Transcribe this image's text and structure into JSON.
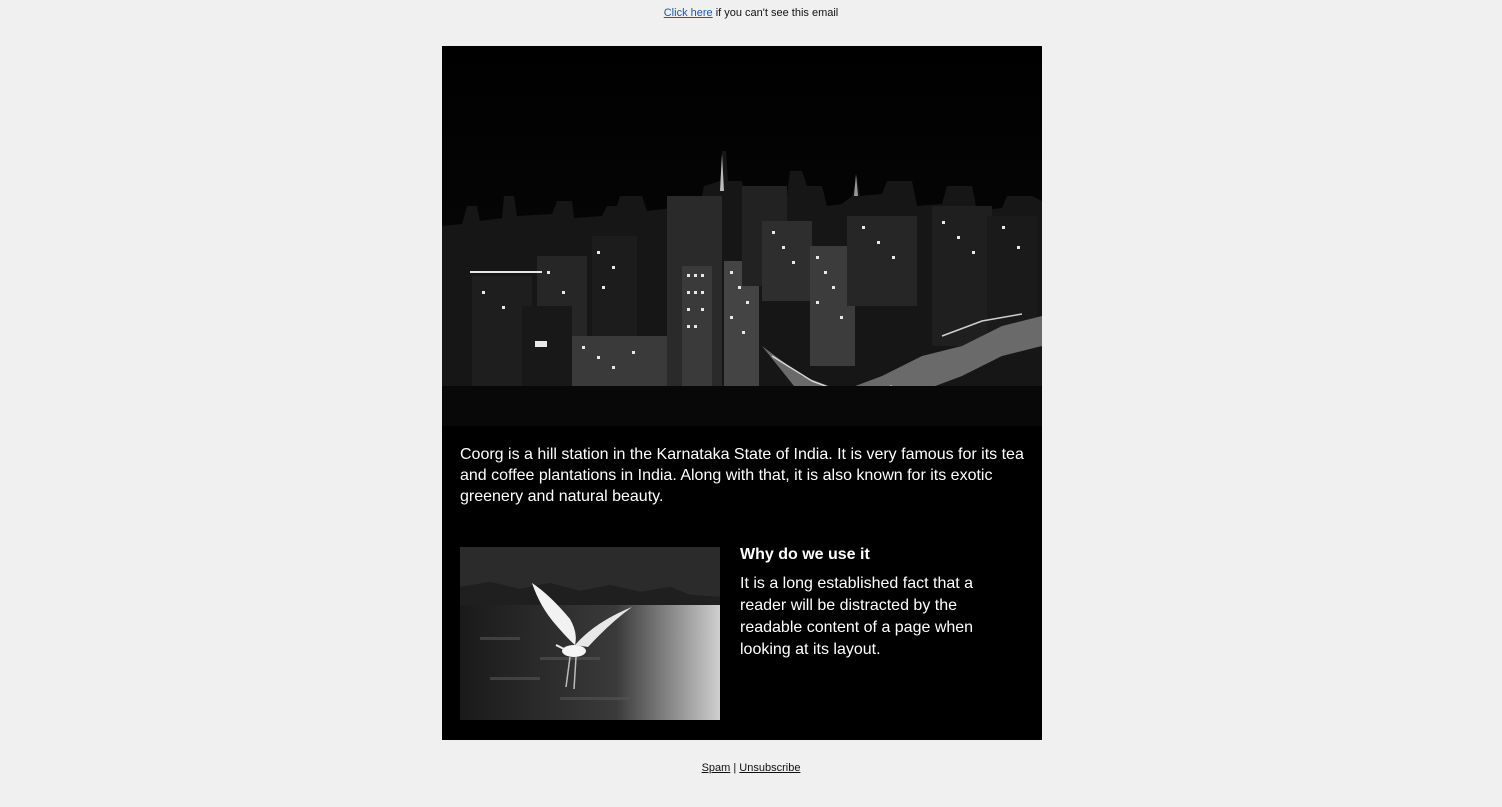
{
  "preheader": {
    "link_text": "Click here",
    "text": " if you can't see this email"
  },
  "hero": {
    "image": "night-city-skyline-photo"
  },
  "intro": {
    "text": "Coorg is a hill station in the Karnataka State of India. It is very famous for its tea and coffee plantations in India. Along with that, it is also known for its exotic greenery and natural beauty."
  },
  "feature": {
    "image": "egret-over-water-photo",
    "title": "Why do we use it",
    "body": "It is a long established fact that a reader will be distracted by the readable content of a page when looking at its layout."
  },
  "footer": {
    "spam": "Spam",
    "separator": "|",
    "unsubscribe": "Unsubscribe"
  },
  "colors": {
    "page_bg": "#f0f0f0",
    "email_bg": "#000000",
    "link": "#1a5aa8"
  }
}
